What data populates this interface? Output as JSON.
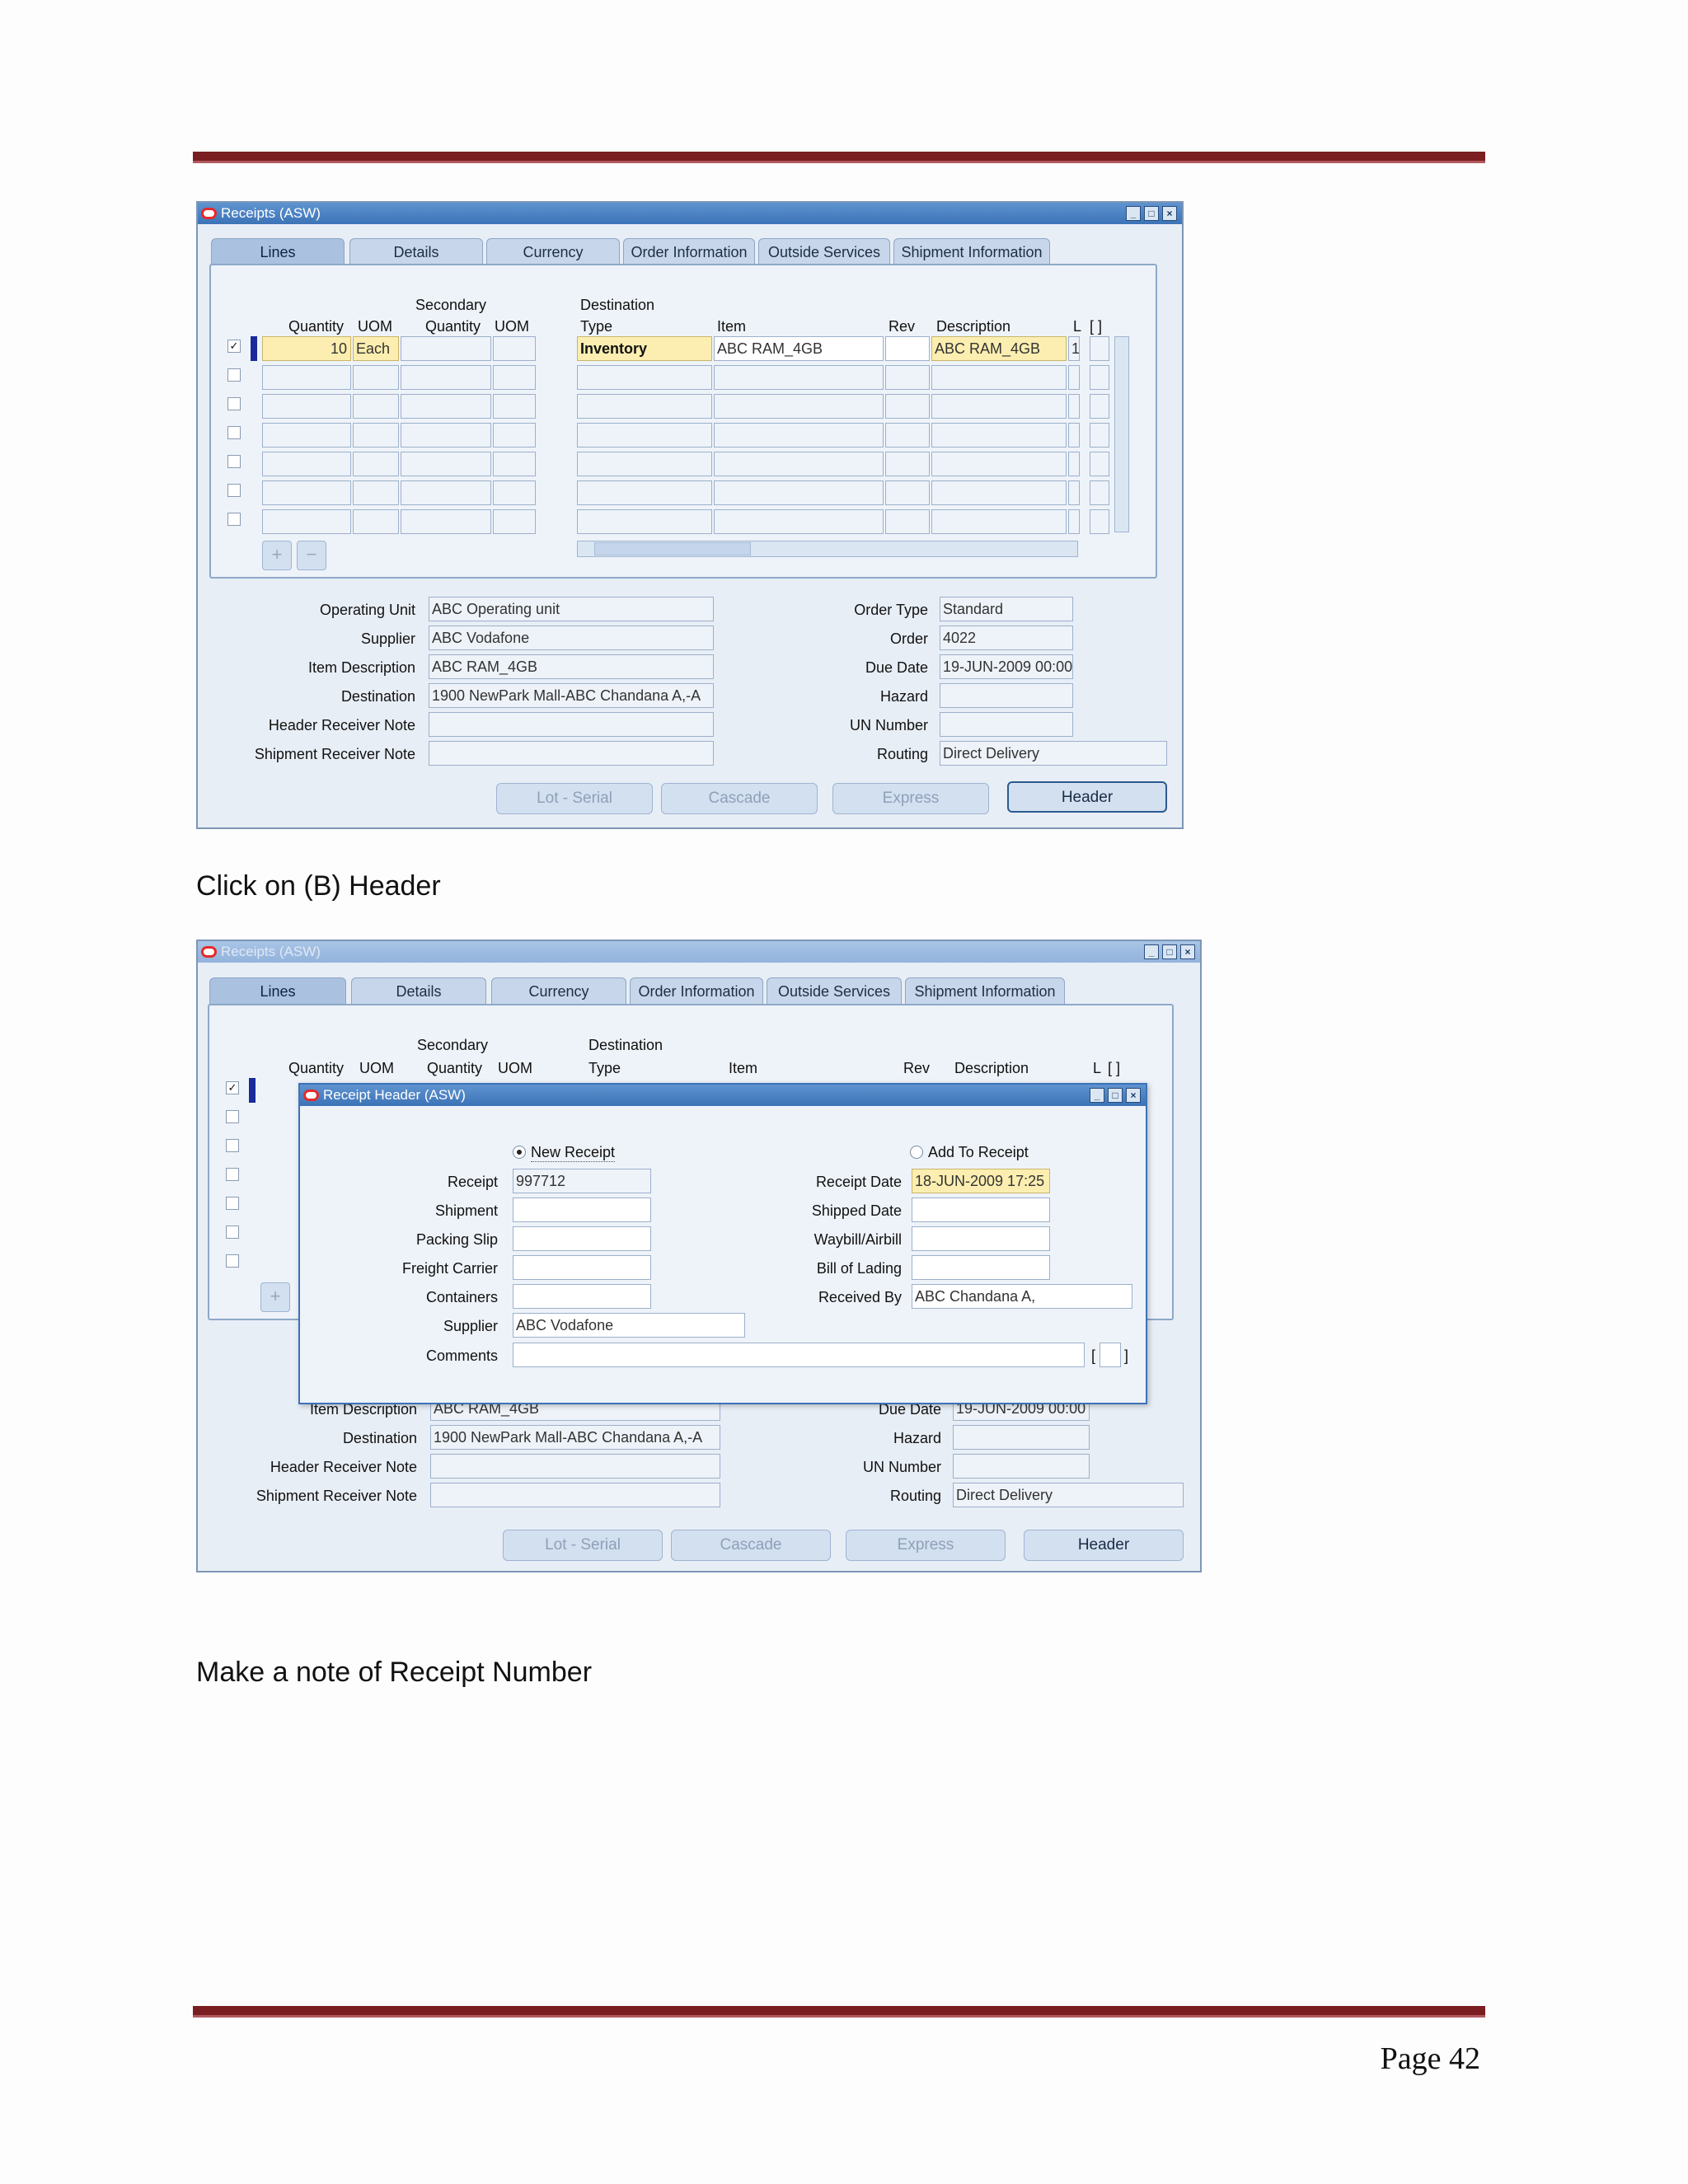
{
  "document": {
    "caption_1": "Click on (B) Header",
    "caption_2": "Make a note of Receipt Number",
    "page_label": "Page 42"
  },
  "form": {
    "title": "Receipts (ASW)",
    "tabs": [
      "Lines",
      "Details",
      "Currency",
      "Order Information",
      "Outside Services",
      "Shipment Information"
    ],
    "columns": {
      "secondary": "Secondary",
      "destination": "Destination",
      "quantity": "Quantity",
      "uom": "UOM",
      "sec_quantity": "Quantity",
      "sec_uom": "UOM",
      "type": "Type",
      "item": "Item",
      "rev": "Rev",
      "description": "Description",
      "l": "L",
      "bracket": "[ ]"
    },
    "line": {
      "quantity": "10",
      "uom": "Each",
      "type": "Inventory",
      "item": "ABC RAM_4GB",
      "description": "ABC RAM_4GB",
      "l": "1"
    },
    "fields": {
      "operating_unit_label": "Operating Unit",
      "operating_unit": "ABC Operating unit",
      "supplier_label": "Supplier",
      "supplier": "ABC Vodafone",
      "item_description_label": "Item Description",
      "item_description": "ABC RAM_4GB",
      "destination_label": "Destination",
      "destination": "1900 NewPark Mall-ABC Chandana A,-A",
      "header_note_label": "Header Receiver Note",
      "shipment_note_label": "Shipment Receiver Note",
      "order_type_label": "Order Type",
      "order_type": "Standard",
      "order_label": "Order",
      "order": "4022",
      "due_date_label": "Due Date",
      "due_date": "19-JUN-2009 00:00",
      "hazard_label": "Hazard",
      "un_number_label": "UN Number",
      "routing_label": "Routing",
      "routing": "Direct Delivery"
    },
    "buttons": {
      "lot_serial": "Lot - Serial",
      "cascade": "Cascade",
      "express": "Express",
      "header": "Header"
    }
  },
  "dialog": {
    "title": "Receipt Header (ASW)",
    "new_receipt": "New Receipt",
    "add_to_receipt": "Add To Receipt",
    "receipt_label": "Receipt",
    "receipt": "997712",
    "shipment_label": "Shipment",
    "packing_slip_label": "Packing Slip",
    "freight_carrier_label": "Freight Carrier",
    "containers_label": "Containers",
    "supplier_label": "Supplier",
    "supplier": "ABC Vodafone",
    "comments_label": "Comments",
    "receipt_date_label": "Receipt Date",
    "receipt_date": "18-JUN-2009 17:25",
    "shipped_date_label": "Shipped Date",
    "waybill_label": "Waybill/Airbill",
    "bill_of_lading_label": "Bill of Lading",
    "received_by_label": "Received By",
    "received_by": "ABC Chandana A,",
    "flex_left": "[",
    "flex_right": "]"
  },
  "icons": {
    "add_row": "plus-icon",
    "delete_row": "minus-icon",
    "oracle_logo": "oracle-logo-icon"
  },
  "colors": {
    "titlebar": "#3c73b7",
    "rule": "#7a1e22",
    "required_field": "#fbeeb0",
    "row_marker": "#1a2a9a"
  }
}
